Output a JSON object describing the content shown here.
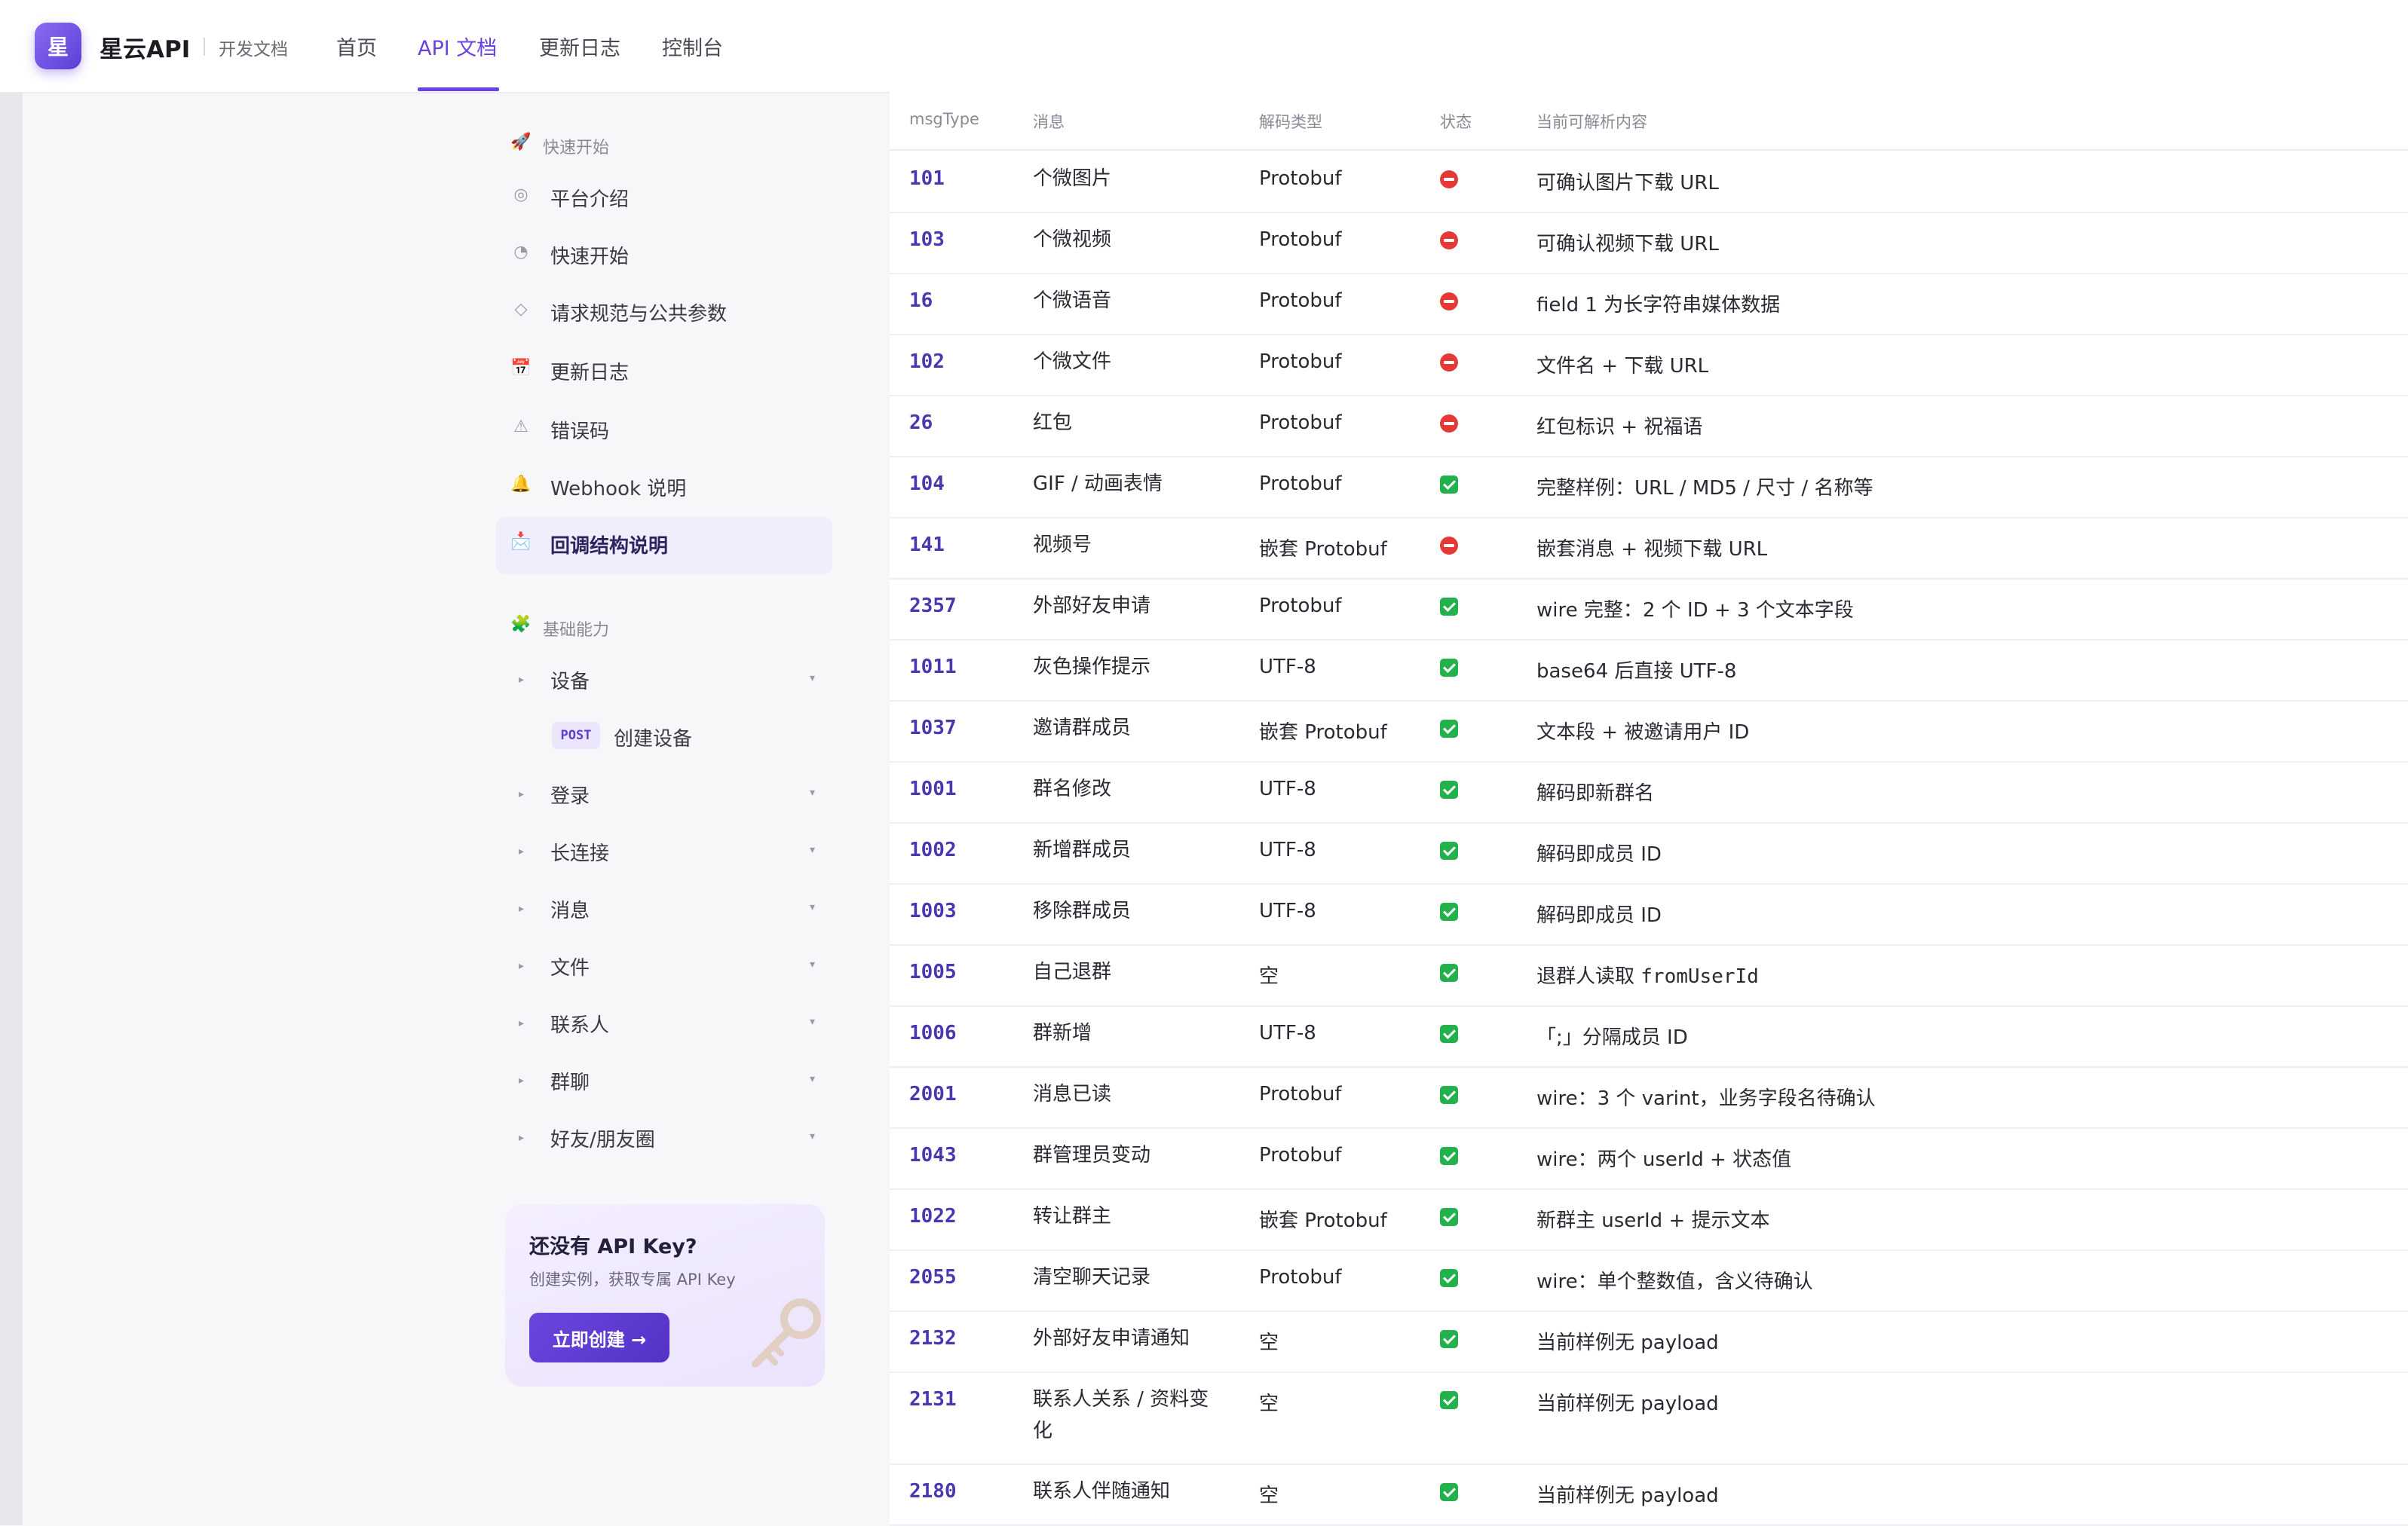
{
  "header": {
    "logo_char": "星",
    "brand": "星云API",
    "subtitle": "开发文档",
    "nav": [
      "首页",
      "API 文档",
      "更新日志",
      "控制台"
    ],
    "active_nav": "API 文档"
  },
  "sidebar": {
    "section1": {
      "title": "快速开始",
      "icon": "rocket-icon"
    },
    "items": [
      {
        "label": "平台介绍",
        "icon": "target-icon"
      },
      {
        "label": "快速开始",
        "icon": "clock-icon"
      },
      {
        "label": "请求规范与公共参数",
        "icon": "diamond-icon"
      },
      {
        "label": "更新日志",
        "icon": "calendar-icon"
      },
      {
        "label": "错误码",
        "icon": "warning-icon"
      },
      {
        "label": "Webhook 说明",
        "icon": "bell-icon"
      },
      {
        "label": "回调结构说明",
        "icon": "inbox-icon",
        "active": true
      }
    ],
    "section2": {
      "title": "基础能力",
      "icon": "puzzle-icon"
    },
    "groups": [
      {
        "label": "设备"
      },
      {
        "label": "登录"
      },
      {
        "label": "长连接"
      },
      {
        "label": "消息"
      },
      {
        "label": "文件"
      },
      {
        "label": "联系人"
      },
      {
        "label": "群聊"
      },
      {
        "label": "好友/朋友圈"
      }
    ],
    "sub_item": {
      "method": "POST",
      "label": "创建设备"
    }
  },
  "card": {
    "title": "还没有 API Key?",
    "subtitle": "创建实例，获取专属 API Key",
    "button": "立即创建 →"
  },
  "table": {
    "headers": [
      "msgType",
      "消息",
      "解码类型",
      "状态",
      "当前可解析内容"
    ],
    "rows": [
      [
        "101",
        "个微图片",
        "Protobuf",
        "no",
        "可确认图片下载 URL"
      ],
      [
        "103",
        "个微视频",
        "Protobuf",
        "no",
        "可确认视频下载 URL"
      ],
      [
        "16",
        "个微语音",
        "Protobuf",
        "no",
        "field 1 为长字符串媒体数据"
      ],
      [
        "102",
        "个微文件",
        "Protobuf",
        "no",
        "文件名 + 下载 URL"
      ],
      [
        "26",
        "红包",
        "Protobuf",
        "no",
        "红包标识 + 祝福语"
      ],
      [
        "104",
        "GIF / 动画表情",
        "Protobuf",
        "ok",
        "完整样例：URL / MD5 / 尺寸 / 名称等"
      ],
      [
        "141",
        "视频号",
        "嵌套 Protobuf",
        "no",
        "嵌套消息 + 视频下载 URL"
      ],
      [
        "2357",
        "外部好友申请",
        "Protobuf",
        "ok",
        "wire 完整：2 个 ID + 3 个文本字段"
      ],
      [
        "1011",
        "灰色操作提示",
        "UTF-8",
        "ok",
        "base64 后直接 UTF-8"
      ],
      [
        "1037",
        "邀请群成员",
        "嵌套 Protobuf",
        "ok",
        "文本段 + 被邀请用户 ID"
      ],
      [
        "1001",
        "群名修改",
        "UTF-8",
        "ok",
        "解码即新群名"
      ],
      [
        "1002",
        "新增群成员",
        "UTF-8",
        "ok",
        "解码即成员 ID"
      ],
      [
        "1003",
        "移除群成员",
        "UTF-8",
        "ok",
        "解码即成员 ID"
      ],
      [
        "1005",
        "自己退群",
        "空",
        "ok",
        "退群人读取 fromUserId"
      ],
      [
        "1006",
        "群新增",
        "UTF-8",
        "ok",
        "「;」分隔成员 ID"
      ],
      [
        "2001",
        "消息已读",
        "Protobuf",
        "ok",
        "wire：3 个 varint，业务字段名待确认"
      ],
      [
        "1043",
        "群管理员变动",
        "Protobuf",
        "ok",
        "wire：两个 userId + 状态值"
      ],
      [
        "1022",
        "转让群主",
        "嵌套 Protobuf",
        "ok",
        "新群主 userId + 提示文本"
      ],
      [
        "2055",
        "清空聊天记录",
        "Protobuf",
        "ok",
        "wire：单个整数值，含义待确认"
      ],
      [
        "2132",
        "外部好友申请通知",
        "空",
        "ok",
        "当前样例无 payload"
      ],
      [
        "2131",
        "联系人关系 / 资料变化",
        "空",
        "ok",
        "当前样例无 payload"
      ],
      [
        "2180",
        "联系人伴随通知",
        "空",
        "ok",
        "当前样例无 payload"
      ]
    ]
  }
}
